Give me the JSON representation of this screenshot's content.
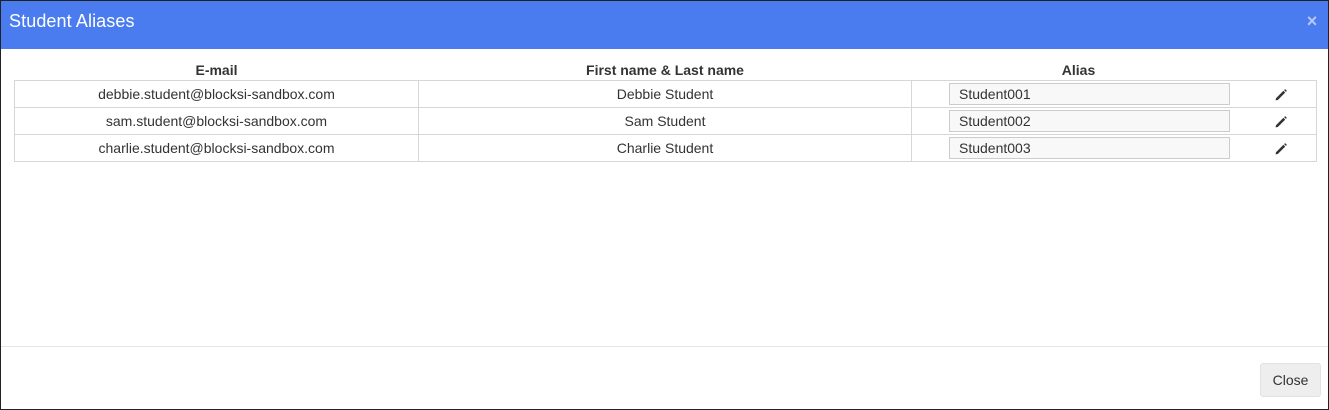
{
  "modal": {
    "title": "Student Aliases",
    "close_glyph": "×",
    "close_button_label": "Close"
  },
  "table": {
    "headers": {
      "email": "E-mail",
      "name": "First name & Last name",
      "alias": "Alias"
    },
    "rows": [
      {
        "email": "debbie.student@blocksi-sandbox.com",
        "name": "Debbie Student",
        "alias": "Student001"
      },
      {
        "email": "sam.student@blocksi-sandbox.com",
        "name": "Sam Student",
        "alias": "Student002"
      },
      {
        "email": "charlie.student@blocksi-sandbox.com",
        "name": "Charlie Student",
        "alias": "Student003"
      }
    ]
  },
  "icons": {
    "edit": "pencil-icon",
    "close": "close-icon"
  },
  "colors": {
    "header_bg": "#4a7cf0",
    "header_text": "#ffffff",
    "close_glyph": "#b7c9f8"
  }
}
